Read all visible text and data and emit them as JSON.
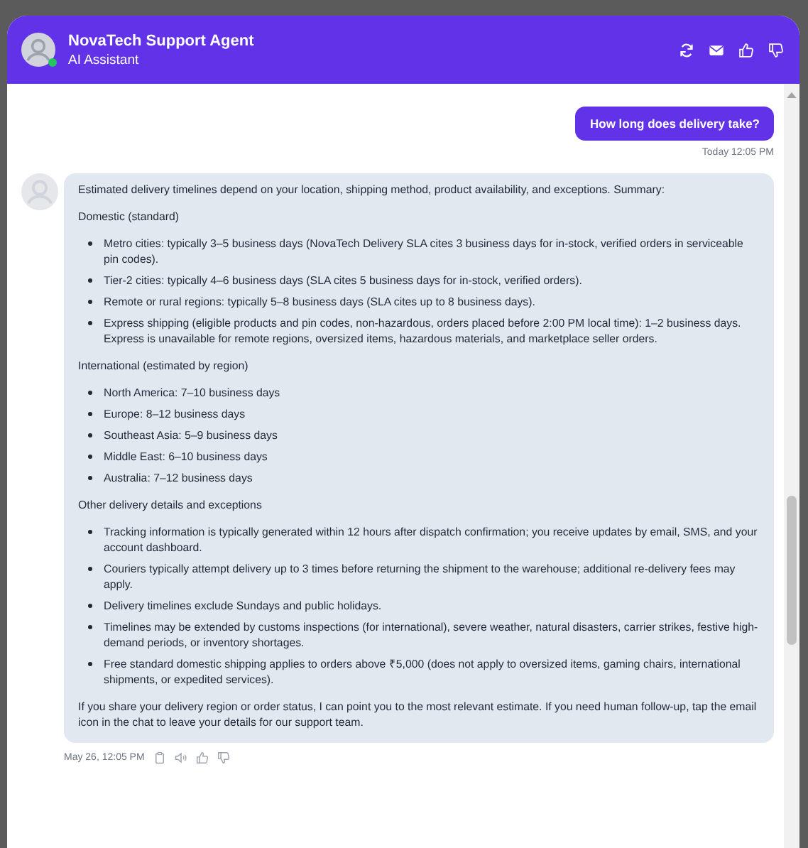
{
  "header": {
    "title": "NovaTech Support Agent",
    "subtitle": "AI Assistant",
    "online": true
  },
  "messages": [
    {
      "kind": "user",
      "text": "How long does delivery take?",
      "time": "Today 12:05 PM"
    },
    {
      "kind": "bot",
      "time": "May 26, 12:05 PM",
      "blocks": [
        {
          "kind": "paragraph",
          "text": "Estimated delivery timelines depend on your location, shipping method, product availability, and exceptions. Summary:"
        },
        {
          "kind": "paragraph",
          "text": "Domestic (standard)"
        },
        {
          "kind": "list",
          "items": [
            "Metro cities: typically 3–5 business days (NovaTech Delivery SLA cites 3 business days for in-stock, verified orders in serviceable pin codes).",
            "Tier-2 cities: typically 4–6 business days (SLA cites 5 business days for in-stock, verified orders).",
            "Remote or rural regions: typically 5–8 business days (SLA cites up to 8 business days).",
            "Express shipping (eligible products and pin codes, non-hazardous, orders placed before 2:00 PM local time): 1–2 business days. Express is unavailable for remote regions, oversized items, hazardous materials, and marketplace seller orders."
          ]
        },
        {
          "kind": "paragraph",
          "text": "International (estimated by region)"
        },
        {
          "kind": "list",
          "items": [
            "North America: 7–10 business days",
            "Europe: 8–12 business days",
            "Southeast Asia: 5–9 business days",
            "Middle East: 6–10 business days",
            "Australia: 7–12 business days"
          ]
        },
        {
          "kind": "paragraph",
          "text": "Other delivery details and exceptions"
        },
        {
          "kind": "list",
          "items": [
            "Tracking information is typically generated within 12 hours after dispatch confirmation; you receive updates by email, SMS, and your account dashboard.",
            "Couriers typically attempt delivery up to 3 times before returning the shipment to the warehouse; additional re-delivery fees may apply.",
            "Delivery timelines exclude Sundays and public holidays.",
            "Timelines may be extended by customs inspections (for international), severe weather, natural disasters, carrier strikes, festive high-demand periods, or inventory shortages.",
            "Free standard domestic shipping applies to orders above ₹5,000 (does not apply to oversized items, gaming chairs, international shipments, or expedited services)."
          ]
        },
        {
          "kind": "paragraph",
          "text": "If you share your delivery region or order status, I can point you to the most relevant estimate. If you need human follow-up, tap the email icon in the chat to leave your details for our support team."
        }
      ]
    }
  ]
}
